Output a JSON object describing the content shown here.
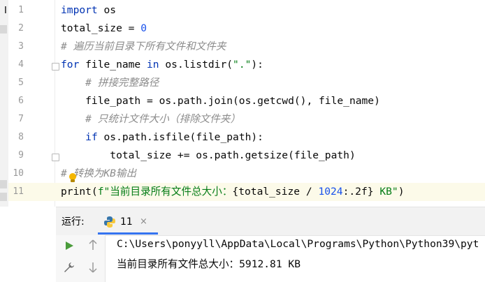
{
  "editor": {
    "lines": [
      {
        "number": "1",
        "tokens": [
          {
            "text": "import",
            "style": "kw"
          },
          {
            "text": " os",
            "style": ""
          }
        ]
      },
      {
        "number": "2",
        "tokens": [
          {
            "text": "total_size = ",
            "style": ""
          },
          {
            "text": "0",
            "style": "num"
          }
        ]
      },
      {
        "number": "3",
        "tokens": [
          {
            "text": "# 遍历当前目录下所有文件和文件夹",
            "style": "cmt"
          }
        ]
      },
      {
        "number": "4",
        "tokens": [
          {
            "text": "for",
            "style": "kw"
          },
          {
            "text": " file_name ",
            "style": ""
          },
          {
            "text": "in",
            "style": "kw"
          },
          {
            "text": " os.listdir(",
            "style": ""
          },
          {
            "text": "\".\"",
            "style": "str"
          },
          {
            "text": "):",
            "style": ""
          }
        ]
      },
      {
        "number": "5",
        "tokens": [
          {
            "text": "    ",
            "style": ""
          },
          {
            "text": "# 拼接完整路径",
            "style": "cmt"
          }
        ]
      },
      {
        "number": "6",
        "tokens": [
          {
            "text": "    file_path = os.path.join(os.getcwd(), file_name)",
            "style": ""
          }
        ]
      },
      {
        "number": "7",
        "tokens": [
          {
            "text": "    ",
            "style": ""
          },
          {
            "text": "# 只统计文件大小（排除文件夹）",
            "style": "cmt"
          }
        ]
      },
      {
        "number": "8",
        "tokens": [
          {
            "text": "    ",
            "style": ""
          },
          {
            "text": "if",
            "style": "kw"
          },
          {
            "text": " os.path.isfile(file_path):",
            "style": ""
          }
        ]
      },
      {
        "number": "9",
        "tokens": [
          {
            "text": "        total_size += os.path.getsize(file_path)",
            "style": ""
          }
        ]
      },
      {
        "number": "10",
        "tokens": [
          {
            "text": "# 转换为KB输出",
            "style": "cmt"
          }
        ]
      },
      {
        "number": "11",
        "tokens": [
          {
            "text": "print(",
            "style": ""
          },
          {
            "text": "f\"当前目录所有文件总大小：",
            "style": "str"
          },
          {
            "text": "{total_size / ",
            "style": ""
          },
          {
            "text": "1024",
            "style": "num"
          },
          {
            "text": ":.2f}",
            "style": ""
          },
          {
            "text": " KB\"",
            "style": "str"
          },
          {
            "text": ")",
            "style": ""
          }
        ]
      }
    ],
    "current_line": "11"
  },
  "run": {
    "title": "运行:",
    "tab_label": "11",
    "tab_close": "×",
    "console": [
      "C:\\Users\\ponyyll\\AppData\\Local\\Programs\\Python\\Python39\\pyt",
      "当前目录所有文件总大小：5912.81 KB"
    ]
  },
  "ide_strip": {
    "glyph": "I"
  },
  "colors": {
    "keyword": "#0033b3",
    "number": "#1750eb",
    "string": "#067d17",
    "comment": "#8c8c8c",
    "current_line": "#fcfae9",
    "run_green": "#4a9c3b",
    "tab_underline": "#3574f0"
  },
  "icons": {
    "run": "run-icon",
    "wrench": "wrench-icon",
    "up": "arrow-up-icon",
    "down": "arrow-down-icon",
    "python": "python-icon",
    "bulb": "lightbulb-icon"
  }
}
